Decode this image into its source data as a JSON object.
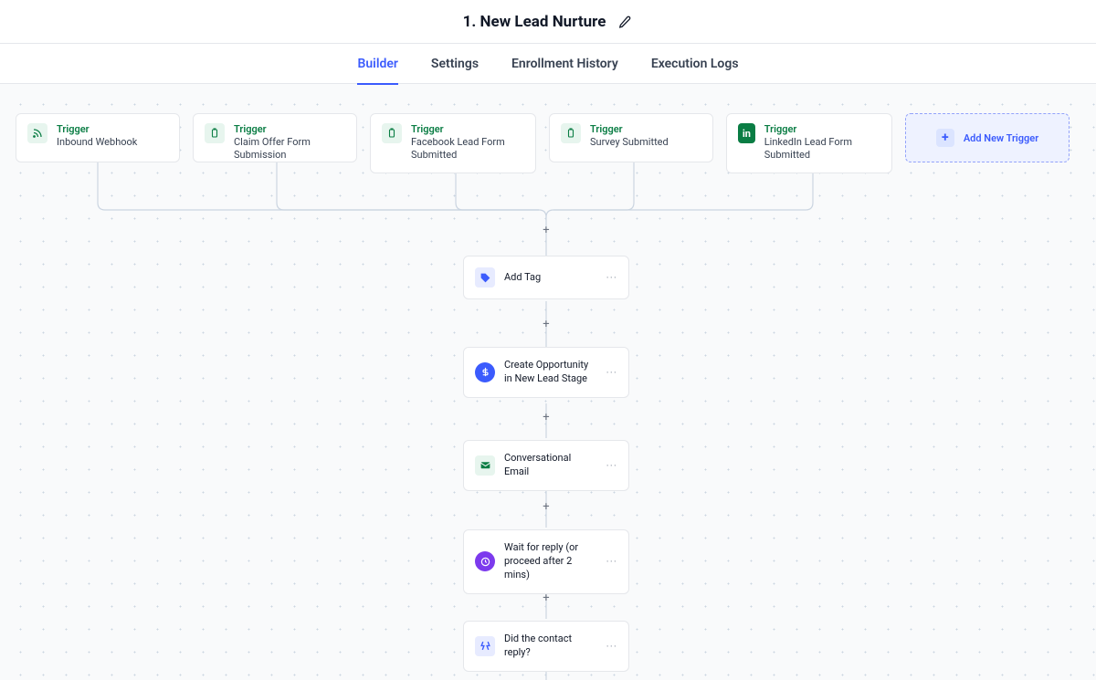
{
  "header": {
    "title": "1. New Lead Nurture"
  },
  "tabs": {
    "builder": "Builder",
    "settings": "Settings",
    "enrollment": "Enrollment History",
    "execution": "Execution Logs"
  },
  "triggers": {
    "label": "Trigger",
    "items": [
      {
        "sub": "Inbound Webhook",
        "icon": "rss"
      },
      {
        "sub": "Claim Offer Form Submission",
        "icon": "clipboard"
      },
      {
        "sub": "Facebook Lead Form Submitted",
        "icon": "clipboard",
        "tall": true
      },
      {
        "sub": "Survey Submitted",
        "icon": "clipboard"
      },
      {
        "sub": "LinkedIn Lead Form Submitted",
        "icon": "linkedin",
        "tall": true
      }
    ],
    "add": "Add New Trigger"
  },
  "steps": [
    {
      "label": "Add Tag",
      "icon": "tag",
      "color": "blue"
    },
    {
      "label": "Create Opportunity in New Lead Stage",
      "icon": "dollar",
      "color": "blue",
      "tall": true
    },
    {
      "label": "Conversational Email",
      "icon": "mail",
      "color": "green"
    },
    {
      "label": "Wait for reply (or proceed after 2 mins)",
      "icon": "clock",
      "color": "purple",
      "tall": true
    },
    {
      "label": "Did the contact reply?",
      "icon": "branch",
      "color": "blue"
    }
  ]
}
